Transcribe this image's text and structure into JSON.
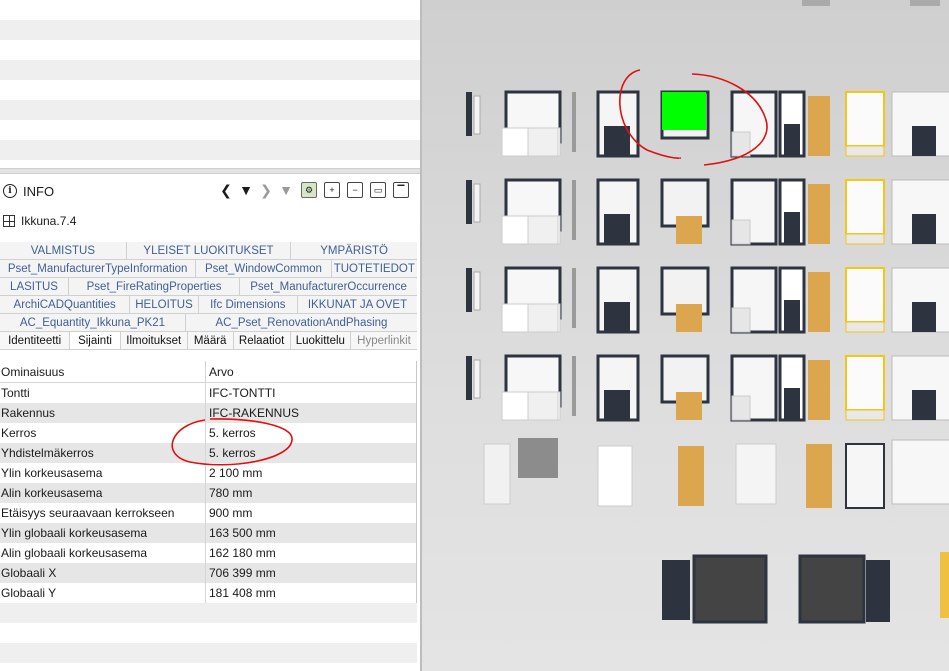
{
  "info_panel": {
    "title": "INFO",
    "object_name": "Ikkuna.7.4",
    "nav": {
      "prev": "❮",
      "menu": "▼",
      "next": "❯",
      "menu2": "▼"
    },
    "tool_icons": [
      "settings-icon",
      "add-object-icon",
      "remove-object-icon",
      "lock-object-icon",
      "window-icon"
    ]
  },
  "tabs": {
    "rows": [
      [
        "VALMISTUS",
        "YLEISET LUOKITUKSET",
        "YMPÄRISTÖ"
      ],
      [
        "Pset_ManufacturerTypeInformation",
        "Pset_WindowCommon",
        "TUOTETIEDOT"
      ],
      [
        "LASITUS",
        "Pset_FireRatingProperties",
        "Pset_ManufacturerOccurrence"
      ],
      [
        "ArchiCADQuantities",
        "HELOITUS",
        "Ifc Dimensions",
        "IKKUNAT JA OVET"
      ],
      [
        "AC_Equantity_Ikkuna_PK21",
        "AC_Pset_RenovationAndPhasing"
      ]
    ],
    "main_row": [
      "Identiteetti",
      "Sijainti",
      "Ilmoitukset",
      "Määrä",
      "Relaatiot",
      "Luokittelu",
      "Hyperlinkit"
    ],
    "active_main": "Sijainti"
  },
  "table": {
    "header": {
      "name": "Ominaisuus",
      "value": "Arvo"
    },
    "rows": [
      {
        "name": "Tontti",
        "value": "IFC-TONTTI"
      },
      {
        "name": "Rakennus",
        "value": "IFC-RAKENNUS"
      },
      {
        "name": "Kerros",
        "value": "5. kerros"
      },
      {
        "name": "Yhdistelmäkerros",
        "value": "5. kerros"
      },
      {
        "name": "Ylin korkeusasema",
        "value": "2 100 mm"
      },
      {
        "name": "Alin korkeusasema",
        "value": "780 mm"
      },
      {
        "name": "Etäisyys seuraavaan kerrokseen",
        "value": "900 mm"
      },
      {
        "name": "Ylin globaali korkeusasema",
        "value": "163 500 mm"
      },
      {
        "name": "Alin globaali korkeusasema",
        "value": "162 180 mm"
      },
      {
        "name": "Globaali X",
        "value": "706 399 mm"
      },
      {
        "name": "Globaali Y",
        "value": "181 408 mm"
      }
    ]
  },
  "colors": {
    "tab_text": "#3f5f96",
    "selected_window": "#00ff00",
    "annotation": "#e01010",
    "window_frame": "#2d3440",
    "door_wood": "#dba64e",
    "selection_outline": "#f5c518"
  }
}
